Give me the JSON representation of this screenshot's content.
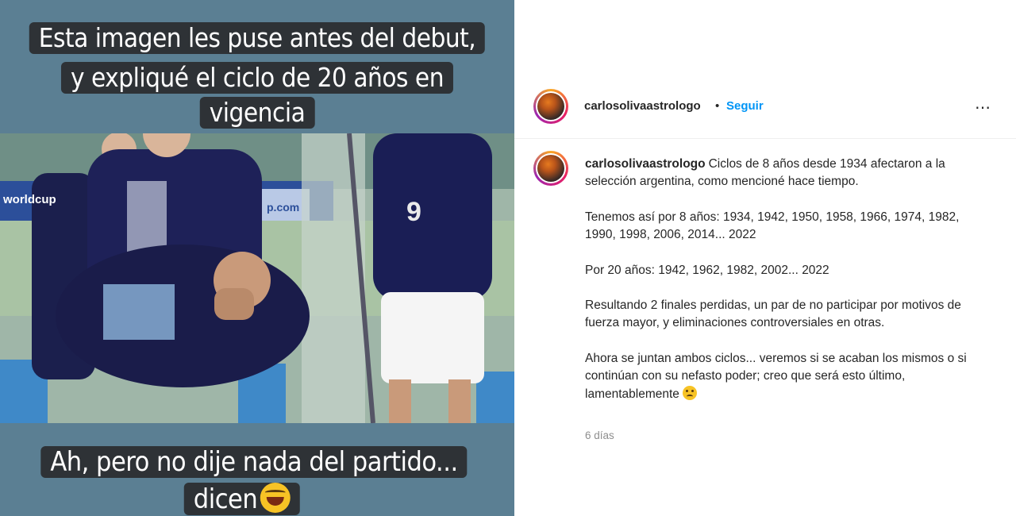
{
  "story": {
    "caption_top_lines": [
      "Esta imagen les puse antes del debut,",
      "y expliqué el ciclo de 20 años en",
      "vigencia"
    ],
    "caption_bottom_lines": [
      "Ah, pero no dije nada del partido...",
      "dicen"
    ],
    "photo_banner_left": "worldcup",
    "photo_banner_right": "p.com",
    "jersey_number": "9",
    "emoji": "rolling-on-floor-laughing"
  },
  "post": {
    "username": "carlosolivaastrologo",
    "separator": "•",
    "follow_label": "Seguir",
    "more_icon": "⋯",
    "caption_paragraphs": [
      "Ciclos de 8 años desde 1934 afectaron a la selección argentina, como mencioné hace tiempo.",
      "Tenemos así por 8 años: 1934, 1942, 1950, 1958, 1966, 1974, 1982, 1990, 1998, 2006, 2014... 2022",
      "Por 20 años: 1942, 1962, 1982, 2002... 2022",
      "Resultando 2 finales perdidas, un par de no participar por motivos de fuerza mayor, y eliminaciones controversiales en otras.",
      "Ahora se juntan ambos ciclos... veremos si se acaban los mismos o si continúan con su nefasto poder; creo que será esto último, lamentablemente"
    ],
    "caption_emoji": "confused-face",
    "timestamp": "6 días",
    "colors": {
      "follow": "#0095f6",
      "text": "#262626",
      "muted": "#8e8e8e"
    }
  }
}
